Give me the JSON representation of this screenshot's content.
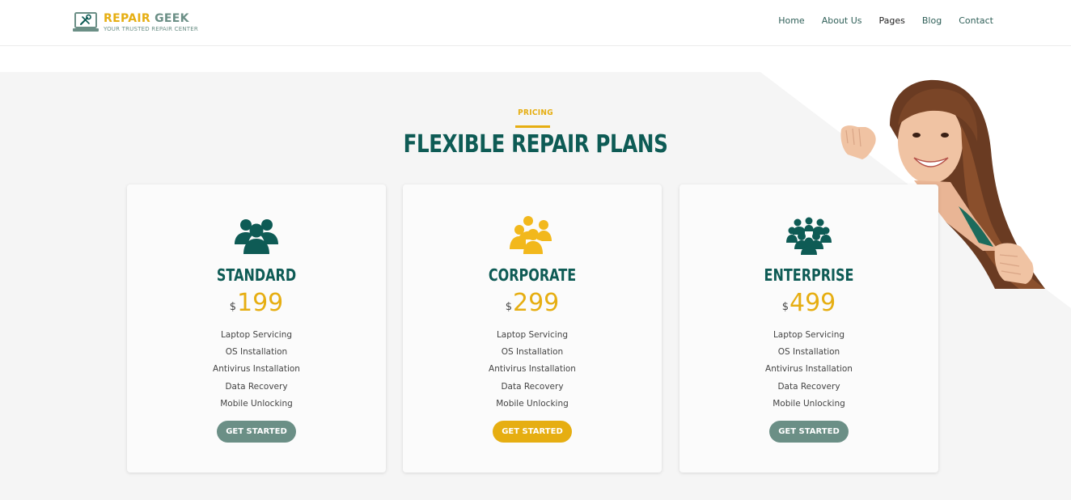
{
  "brand": {
    "name_part1": "REPAIR",
    "name_part2": "GEEK",
    "tagline": "YOUR TRUSTED REPAIR CENTER",
    "icon": "laptop-wrench-icon",
    "colors": {
      "accent": "#e6ae12",
      "muted": "#6b8f86",
      "dark": "#0e5b55"
    }
  },
  "nav": {
    "items": [
      {
        "label": "Home"
      },
      {
        "label": "About Us"
      },
      {
        "label": "Pages"
      },
      {
        "label": "Blog"
      },
      {
        "label": "Contact"
      }
    ]
  },
  "section": {
    "eyebrow": "PRICING",
    "title": "FLEXIBLE REPAIR PLANS"
  },
  "plans": [
    {
      "name": "STANDARD",
      "currency": "$",
      "price": "199",
      "icon": "group-small-icon",
      "icon_color": "#0e5b55",
      "features": [
        "Laptop Servicing",
        "OS Installation",
        "Antivirus Installation",
        "Data Recovery",
        "Mobile Unlocking"
      ],
      "button_label": "GET STARTED",
      "button_color": "#6b8f86"
    },
    {
      "name": "CORPORATE",
      "currency": "$",
      "price": "299",
      "icon": "group-medium-icon",
      "icon_color": "#f2b81c",
      "features": [
        "Laptop Servicing",
        "OS Installation",
        "Antivirus Installation",
        "Data Recovery",
        "Mobile Unlocking"
      ],
      "button_label": "GET STARTED",
      "button_color": "#e6ae12"
    },
    {
      "name": "ENTERPRISE",
      "currency": "$",
      "price": "499",
      "icon": "group-large-icon",
      "icon_color": "#0e5b55",
      "features": [
        "Laptop Servicing",
        "OS Installation",
        "Antivirus Installation",
        "Data Recovery",
        "Mobile Unlocking"
      ],
      "button_label": "GET STARTED",
      "button_color": "#6b8f86"
    }
  ]
}
